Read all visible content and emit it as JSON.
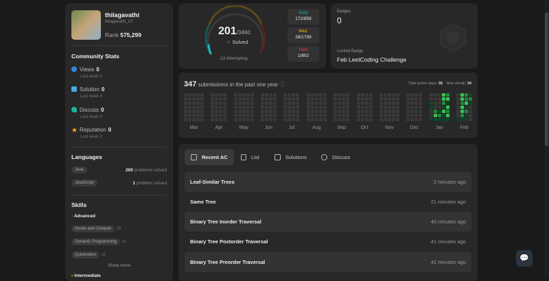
{
  "profile": {
    "name": "thilagavathi",
    "username": "thilagavathi_07",
    "rank_label": "Rank",
    "rank": "575,299"
  },
  "community": {
    "title": "Community Stats",
    "last_week": "Last week",
    "items": [
      {
        "label": "Views",
        "value": "0",
        "lw": "0",
        "color": "#2e86de",
        "icon": "eye-icon"
      },
      {
        "label": "Solution",
        "value": "0",
        "lw": "0",
        "color": "#48a9e6",
        "icon": "solution-icon"
      },
      {
        "label": "Discuss",
        "value": "0",
        "lw": "0",
        "color": "#1db6a0",
        "icon": "discuss-icon"
      },
      {
        "label": "Reputation",
        "value": "0",
        "lw": "0",
        "color": "#f5a623",
        "icon": "star-icon"
      }
    ]
  },
  "languages": {
    "title": "Languages",
    "items": [
      {
        "name": "Java",
        "count": "200",
        "suffix": "problems solved"
      },
      {
        "name": "JavaScript",
        "count": "1",
        "suffix": "problem solved"
      }
    ]
  },
  "skills": {
    "title": "Skills",
    "advanced": "Advanced",
    "intermediate": "Intermediate",
    "show_more": "Show more",
    "items": [
      {
        "name": "Divide and Conquer",
        "count": "x5"
      },
      {
        "name": "Dynamic Programming",
        "count": "x2"
      },
      {
        "name": "Quickselect",
        "count": "x1"
      }
    ]
  },
  "solved": {
    "count": "201",
    "total": "/3460",
    "label": "Solved",
    "attempting": "13 Attempting",
    "fraction": 0.058,
    "easy": {
      "label": "Easy",
      "value": "172/859",
      "color": "#1cbaba"
    },
    "medium": {
      "label": "Med.",
      "value": "28/1799",
      "color": "#ffb700"
    },
    "hard": {
      "label": "Hard",
      "value": "1/802",
      "color": "#f63737"
    }
  },
  "badges": {
    "title": "Badges",
    "count": "0",
    "locked_label": "Locked Badge",
    "locked_name": "Feb LeetCoding Challenge"
  },
  "heatmap": {
    "count": "347",
    "text": "submissions in the past one year",
    "active_label": "Total active days:",
    "active": "38",
    "streak_label": "Max streak:",
    "streak": "34",
    "months": [
      {
        "name": "Mar",
        "cols": [
          "0000000",
          "0000000",
          "0000000",
          "0000000",
          "0000000"
        ]
      },
      {
        "name": "Apr",
        "cols": [
          "0000000",
          "0000000",
          "0000000",
          "0000000"
        ]
      },
      {
        "name": "May",
        "cols": [
          "0000000",
          "0000000",
          "0000000",
          "0000000",
          "0000000"
        ]
      },
      {
        "name": "Jun",
        "cols": [
          "0000000",
          "0000000",
          "0000000",
          "0000000"
        ]
      },
      {
        "name": "Jul",
        "cols": [
          "0000000",
          "0000000",
          "0000000",
          "0000000"
        ]
      },
      {
        "name": "Aug",
        "cols": [
          "0000000",
          "0000000",
          "0000000",
          "0000000",
          "0000000"
        ]
      },
      {
        "name": "Sep",
        "cols": [
          "0000000",
          "0000000",
          "0000000",
          "0000000"
        ]
      },
      {
        "name": "Oct",
        "cols": [
          "0000000",
          "0000000",
          "0000000",
          "0000000"
        ]
      },
      {
        "name": "Nov",
        "cols": [
          "0000000",
          "0000000",
          "0000000",
          "0000000",
          "0000000"
        ]
      },
      {
        "name": "Dec",
        "cols": [
          "0000000",
          "0000000",
          "0000000",
          "0000000"
        ]
      },
      {
        "name": "Jan",
        "cols": [
          "0011001",
          "0000231",
          "0000121",
          "3321311",
          "2313231"
        ]
      },
      {
        "name": "Feb",
        "cols": [
          "0000001",
          "3323321",
          "2231211",
          "1210000"
        ]
      }
    ],
    "colors": [
      "#393939",
      "#0e4429",
      "#1f8a3b",
      "#39c353"
    ]
  },
  "tabs": [
    {
      "label": "Recent AC"
    },
    {
      "label": "List"
    },
    {
      "label": "Solutions"
    },
    {
      "label": "Discuss"
    }
  ],
  "recent": [
    {
      "title": "Leaf-Similar Trees",
      "time": "2 minutes ago"
    },
    {
      "title": "Same Tree",
      "time": "21 minutes ago"
    },
    {
      "title": "Binary Tree Inorder Traversal",
      "time": "40 minutes ago"
    },
    {
      "title": "Binary Tree Postorder Traversal",
      "time": "41 minutes ago"
    },
    {
      "title": "Binary Tree Preorder Traversal",
      "time": "42 minutes ago"
    }
  ]
}
